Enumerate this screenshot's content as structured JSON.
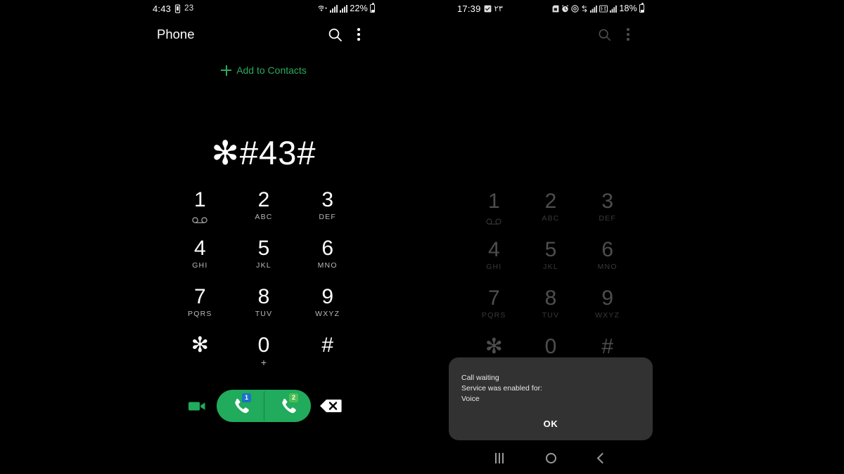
{
  "left_phone": {
    "status_bar": {
      "time": "4:43",
      "vibrate_icon": "vibrate-icon",
      "notification_count": "23",
      "wifi_icon": "wifi-icon",
      "signal_icon_1": "signal-bars-icon",
      "signal_icon_2": "signal-bars-icon",
      "battery_percent": "22%",
      "battery_icon": "battery-icon"
    },
    "header": {
      "title": "Phone",
      "search_icon": "search-icon",
      "menu_icon": "overflow-menu-icon"
    },
    "add_to_contacts": {
      "label": "Add to Contacts",
      "icon": "plus-icon"
    },
    "dialed_number": "✻#43#",
    "keypad": [
      {
        "digit": "1",
        "sub": "",
        "icon": "voicemail-icon"
      },
      {
        "digit": "2",
        "sub": "ABC",
        "icon": ""
      },
      {
        "digit": "3",
        "sub": "DEF",
        "icon": ""
      },
      {
        "digit": "4",
        "sub": "GHI",
        "icon": ""
      },
      {
        "digit": "5",
        "sub": "JKL",
        "icon": ""
      },
      {
        "digit": "6",
        "sub": "MNO",
        "icon": ""
      },
      {
        "digit": "7",
        "sub": "PQRS",
        "icon": ""
      },
      {
        "digit": "8",
        "sub": "TUV",
        "icon": ""
      },
      {
        "digit": "9",
        "sub": "WXYZ",
        "icon": ""
      },
      {
        "digit": "✻",
        "sub": "",
        "icon": ""
      },
      {
        "digit": "0",
        "sub": "+",
        "icon": ""
      },
      {
        "digit": "#",
        "sub": "",
        "icon": ""
      }
    ],
    "actions": {
      "video_call_icon": "video-camera-icon",
      "call_sim1_label": "1",
      "call_sim2_label": "2",
      "call_icon": "phone-handset-icon",
      "backspace_icon": "backspace-icon"
    }
  },
  "right_phone": {
    "status_bar": {
      "time": "17:39",
      "calendar_icon": "calendar-icon",
      "notification_count": "٢٣",
      "sim_icon": "sim-card-icon",
      "alarm_icon": "alarm-clock-icon",
      "dnd_icon": "do-not-disturb-icon",
      "sync_icon": "sync-icon",
      "signal_icon_1": "signal-bars-icon",
      "data_icon": "mobile-data-icon",
      "signal_icon_2": "signal-bars-icon",
      "battery_percent": "18%",
      "battery_icon": "battery-icon"
    },
    "header": {
      "search_icon": "search-icon",
      "menu_icon": "overflow-menu-icon"
    },
    "keypad": [
      {
        "digit": "1",
        "sub": "",
        "icon": "voicemail-icon"
      },
      {
        "digit": "2",
        "sub": "ABC",
        "icon": ""
      },
      {
        "digit": "3",
        "sub": "DEF",
        "icon": ""
      },
      {
        "digit": "4",
        "sub": "GHI",
        "icon": ""
      },
      {
        "digit": "5",
        "sub": "JKL",
        "icon": ""
      },
      {
        "digit": "6",
        "sub": "MNO",
        "icon": ""
      },
      {
        "digit": "7",
        "sub": "PQRS",
        "icon": ""
      },
      {
        "digit": "8",
        "sub": "TUV",
        "icon": ""
      },
      {
        "digit": "9",
        "sub": "WXYZ",
        "icon": ""
      },
      {
        "digit": "✻",
        "sub": "",
        "icon": ""
      },
      {
        "digit": "0",
        "sub": "+",
        "icon": ""
      },
      {
        "digit": "#",
        "sub": "",
        "icon": ""
      }
    ],
    "dialog": {
      "title": "Call waiting",
      "body_line1": "Service was enabled for:",
      "body_line2": "Voice",
      "ok_label": "OK"
    },
    "nav_bar": {
      "recents_icon": "recents-icon",
      "home_icon": "home-icon",
      "back_icon": "back-icon"
    }
  },
  "colors": {
    "background": "#000000",
    "accent_green": "#21ab5c",
    "link_green": "#2aab5e",
    "dialog_bg": "#323232",
    "sim1_badge": "#1a73c8",
    "sim2_badge": "#4fbf52",
    "text_primary": "#ffffff",
    "text_secondary": "#b9b9b9"
  }
}
